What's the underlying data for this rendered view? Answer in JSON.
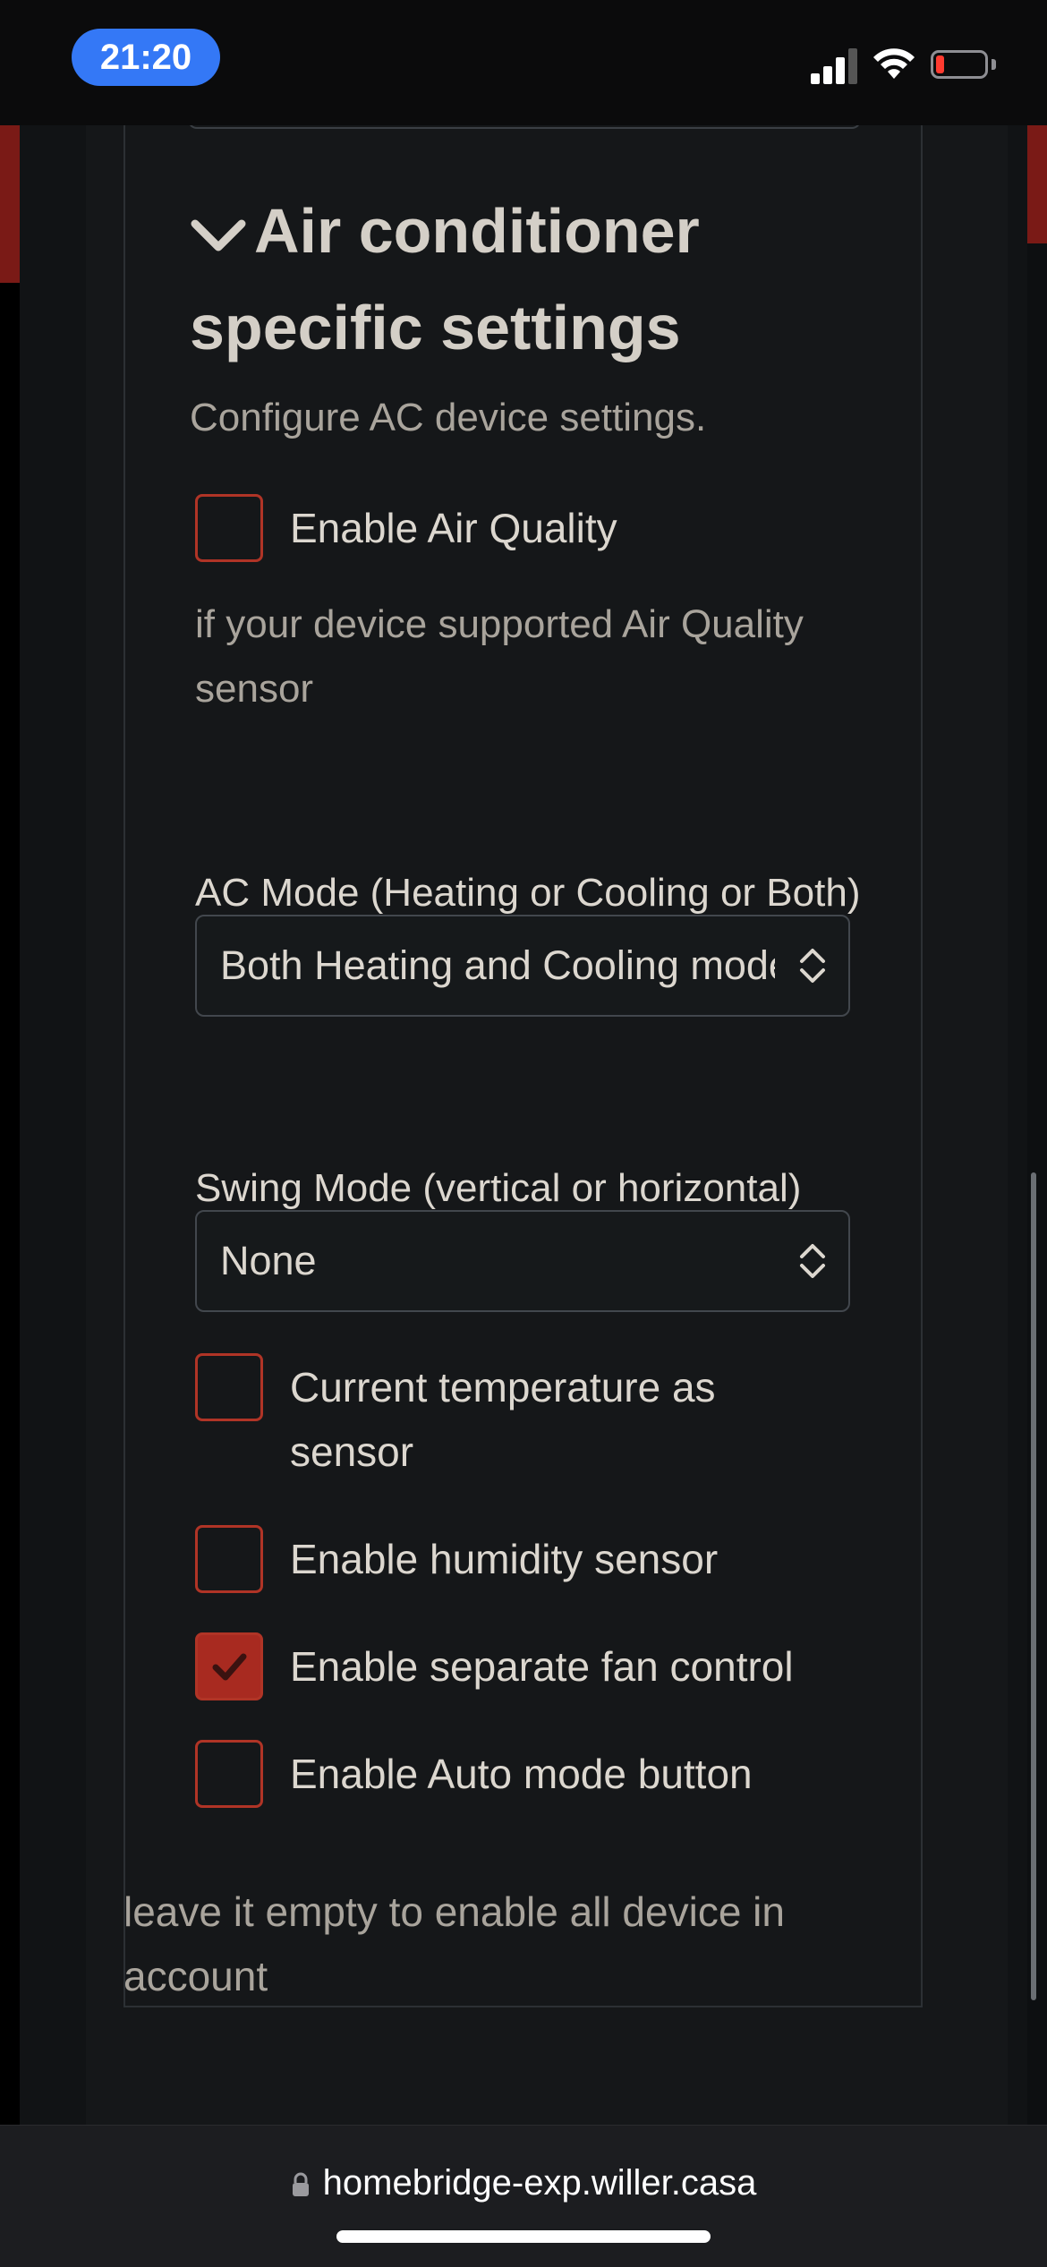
{
  "status_bar": {
    "time": "21:20"
  },
  "section": {
    "title": "Air conditioner specific settings",
    "description": "Configure AC device settings."
  },
  "fields": {
    "air_quality": {
      "label": "Enable Air Quality",
      "checked": false,
      "help": "if your device supported Air Quality sensor"
    },
    "ac_mode": {
      "label": "AC Mode (Heating or Cooling or Both)",
      "value": "Both Heating and Cooling mode"
    },
    "swing_mode": {
      "label": "Swing Mode (vertical or horizontal)",
      "value": "None"
    },
    "temp_sensor": {
      "label": "Current temperature as sensor",
      "checked": false
    },
    "humidity": {
      "label": "Enable humidity sensor",
      "checked": false
    },
    "fan_control": {
      "label": "Enable separate fan control",
      "checked": true
    },
    "auto_mode": {
      "label": "Enable Auto mode button",
      "checked": false
    }
  },
  "footer_help": "leave it empty to enable all device in account",
  "browser": {
    "url": "homebridge-exp.willer.casa"
  },
  "colors": {
    "accent": "#a82a20",
    "pill": "#3478f6",
    "background": "#151719"
  }
}
